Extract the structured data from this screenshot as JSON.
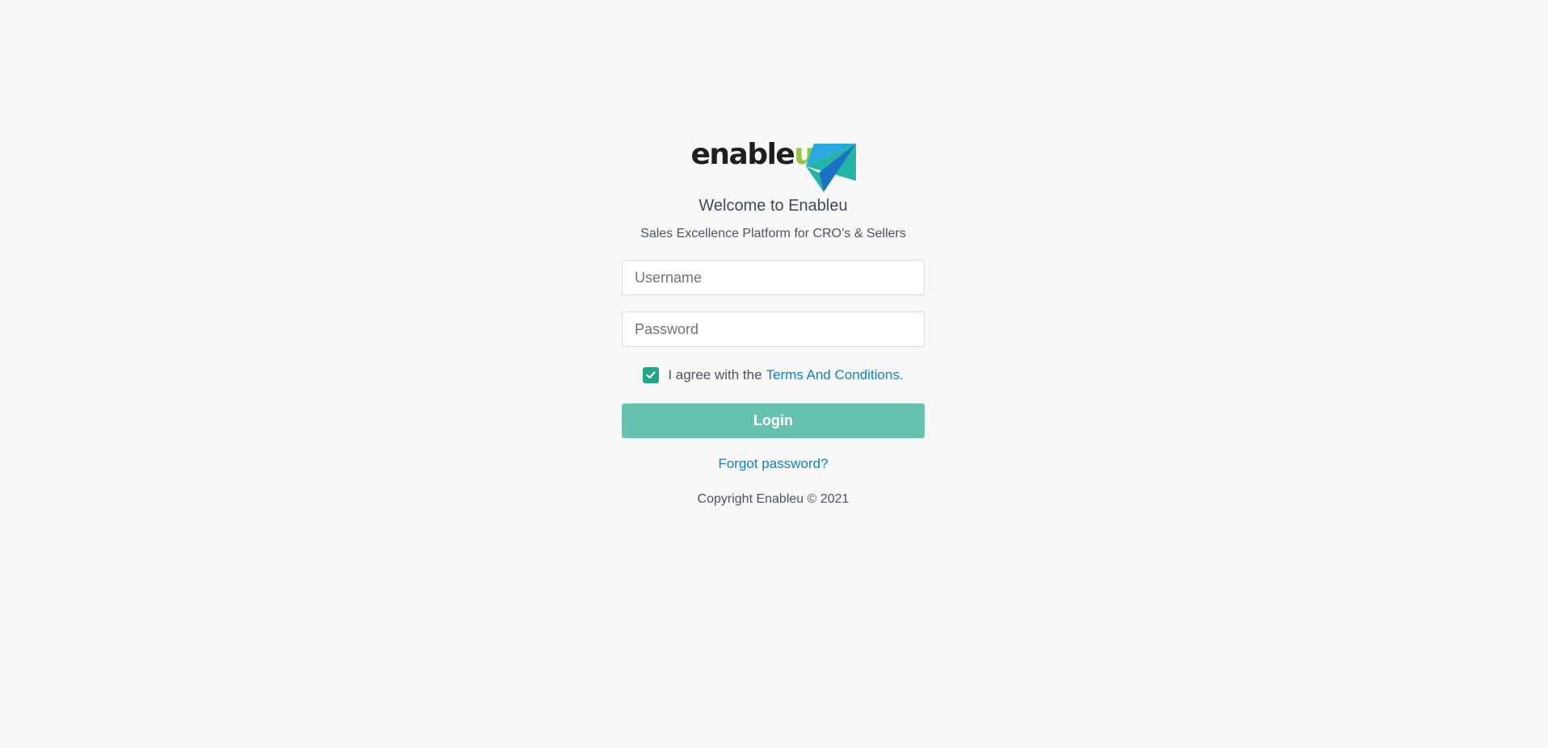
{
  "brand": {
    "logo_text_main": "enable",
    "logo_text_accent": "u",
    "colors": {
      "text": "#1f1f1f",
      "accent_green": "#8dc63f",
      "mark_blue_light": "#29a9e1",
      "mark_blue_dark": "#1a72c4",
      "mark_teal": "#22b5a3"
    }
  },
  "header": {
    "title": "Welcome to Enableu",
    "subtitle": "Sales Excellence Platform for CRO’s & Sellers"
  },
  "form": {
    "username_placeholder": "Username",
    "password_placeholder": "Password",
    "agree_prefix": "I agree with the",
    "terms_link": "Terms And Conditions.",
    "agree_checked": true,
    "login_label": "Login",
    "forgot_label": "Forgot password?"
  },
  "footer": {
    "copyright": "Copyright Enableu © 2021"
  },
  "icons": {
    "checkbox": "check-icon"
  },
  "colors": {
    "background": "#f8f8f8",
    "primary": "#66c2b0",
    "checkbox": "#1ea885",
    "link": "#0b83c8"
  }
}
